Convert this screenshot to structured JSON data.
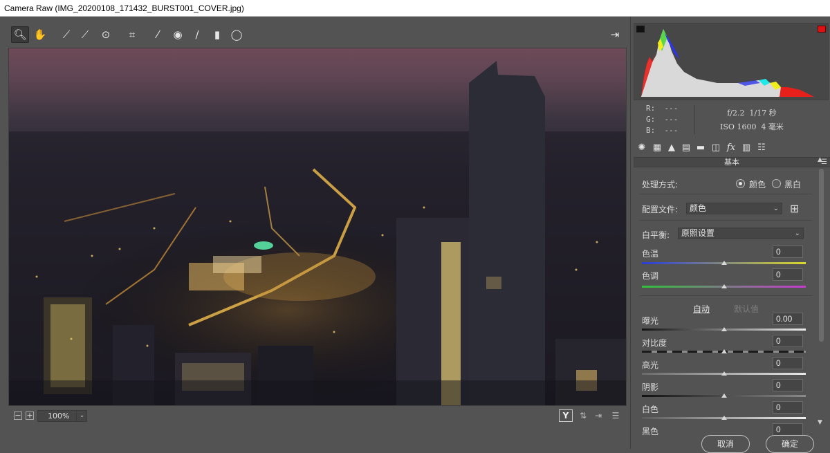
{
  "window": {
    "title": "Camera Raw (IMG_20200108_171432_BURST001_COVER.jpg)"
  },
  "toolbar": {
    "tools": [
      "zoom-icon",
      "hand-icon",
      "white-balance-icon",
      "color-sampler-icon",
      "targeted-adjustment-icon",
      "crop-icon",
      "spot-removal-icon",
      "red-eye-icon",
      "adjustment-brush-icon",
      "graduated-filter-icon",
      "radial-filter-icon"
    ],
    "open_preferences": "open-in-photoshop-icon"
  },
  "bottom_bar": {
    "zoom_out": "−",
    "zoom_in": "+",
    "zoom_level": "100%",
    "zoom_chevron": "⌄",
    "before_after": "Y"
  },
  "histogram": {
    "colors": {
      "red": "#e8201c",
      "green": "#5bd64a",
      "blue": "#2b36e8",
      "yellow": "#f2ee1e",
      "cyan": "#1ee8e8",
      "white": "#d9d9d9"
    }
  },
  "readout": {
    "r_label": "R:",
    "r_value": "---",
    "g_label": "G:",
    "g_value": "---",
    "b_label": "B:",
    "b_value": "---",
    "aperture": "f/2.2",
    "shutter": "1/17 秒",
    "iso": "ISO 1600",
    "focal": "4 毫米"
  },
  "panel_tabs": [
    "basic-icon",
    "tone-curve-icon",
    "detail-icon",
    "hsl-icon",
    "split-toning-icon",
    "lens-icon",
    "fx-icon",
    "camera-calibration-icon",
    "presets-icon"
  ],
  "panel": {
    "title": "基本",
    "treatment_label": "处理方式:",
    "treatment_color": "颜色",
    "treatment_bw": "黑白",
    "treatment_selected": "color",
    "profile_label": "配置文件:",
    "profile_value": "颜色",
    "wb_label": "白平衡:",
    "wb_value": "原照设置",
    "auto": "自动",
    "default": "默认值",
    "sliders": [
      {
        "label": "色温",
        "value": "0",
        "pos": 0.5
      },
      {
        "label": "色调",
        "value": "0",
        "pos": 0.5
      },
      {
        "label": "曝光",
        "value": "0.00",
        "pos": 0.5
      },
      {
        "label": "对比度",
        "value": "0",
        "pos": 0.5
      },
      {
        "label": "高光",
        "value": "0",
        "pos": 0.5
      },
      {
        "label": "阴影",
        "value": "0",
        "pos": 0.5
      },
      {
        "label": "白色",
        "value": "0",
        "pos": 0.5
      },
      {
        "label": "黑色",
        "value": "0",
        "pos": 0.5
      }
    ]
  },
  "buttons": {
    "cancel": "取消",
    "ok": "确定"
  }
}
